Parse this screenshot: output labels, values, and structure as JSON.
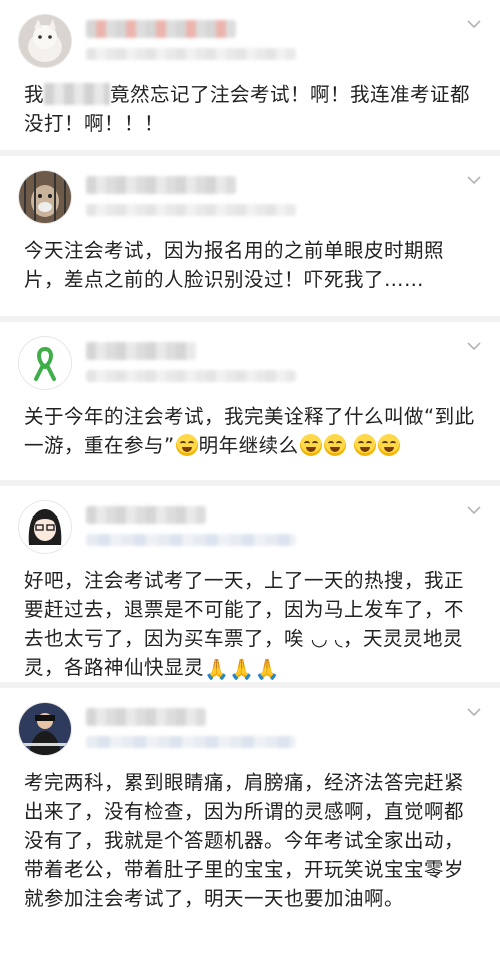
{
  "posts": [
    {
      "text_before": "我",
      "text_after": "竟然忘记了注会考试！啊！我连准考证都没打！啊！！！",
      "emojis": [],
      "tail_text": ""
    },
    {
      "text_before": "今天注会考试，因为报名用的之前单眼皮时期照片，差点之前的人脸识别没过！吓死我了……",
      "text_after": "",
      "emojis": [],
      "tail_text": ""
    },
    {
      "text_before": "关于今年的注会考试，我完美诠释了什么叫做“到此一游，重在参与”",
      "text_after": "明年继续么",
      "emojis": [
        "laugh-cry",
        "laugh-cry",
        "laugh-cry",
        "laugh-cry",
        "laugh-cry"
      ],
      "tail_text": ""
    },
    {
      "text_before": "好吧，注会考试考了一天，上了一天的热搜，我正要赶过去，退票是不可能了，因为马上发车了，不去也太亏了，因为买车票了，唉",
      "text_after": "，天灵灵地灵灵，各路神仙快显灵",
      "emojis": [
        "pray",
        "pray",
        "pray"
      ],
      "tail_text": ""
    },
    {
      "text_before": "考完两科，累到眼睛痛，肩膀痛，经济法答完赶紧出来了，没有检查，因为所谓的灵感啊，直觉啊都没有了，我就是个答题机器。今年考试全家出动，带着老公，带着肚子里的宝宝，开玩笑说宝宝零岁就参加注会考试了，明天一天也要加油啊。",
      "text_after": "",
      "emojis": [],
      "tail_text": ""
    }
  ],
  "icons": {
    "chevron": "chevron-down-icon",
    "ribbon": "green-ribbon-icon"
  },
  "colors": {
    "divider": "#f2f2f2",
    "text": "#222222",
    "ribbon": "#3fae49"
  }
}
